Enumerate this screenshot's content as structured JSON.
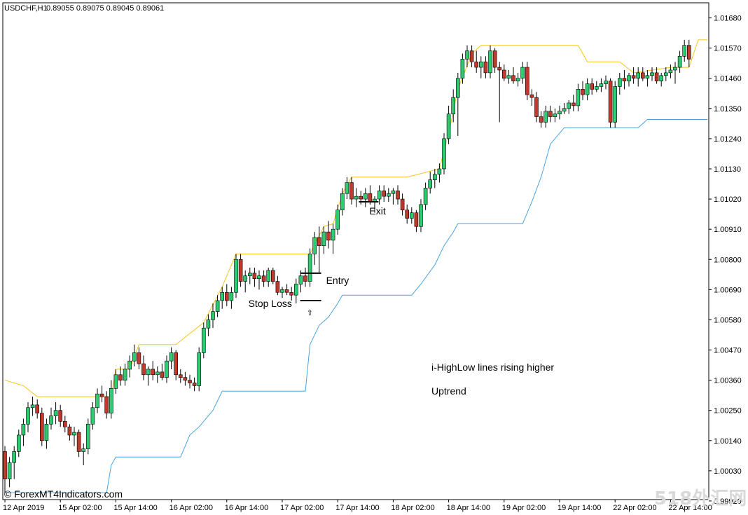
{
  "header": {
    "symbol": "USDCHF,H1",
    "ohlc": "0.89055 0.89075 0.89045 0.89061"
  },
  "copyright": "© ForexMT4Indicators.com",
  "watermark": "518外汇网",
  "colors": {
    "background": "#ffffff",
    "bull": "#2ecc71",
    "bear": "#c0392b",
    "wick": "#000000",
    "high_line": "#f5c518",
    "low_line": "#4aa3df",
    "axis": "#000000"
  },
  "chart_data": {
    "type": "candlestick",
    "ylim": [
      0.99925,
      1.01735
    ],
    "y_ticks": [
      "1.01680",
      "1.01570",
      "1.01460",
      "1.01350",
      "1.01240",
      "1.01130",
      "1.01020",
      "1.00910",
      "1.00800",
      "1.00690",
      "1.00580",
      "1.00470",
      "1.00360",
      "1.00250",
      "1.00140",
      "1.00030",
      "0.99920"
    ],
    "x_ticks": [
      "12 Apr 2019",
      "15 Apr 02:00",
      "15 Apr 14:00",
      "16 Apr 02:00",
      "16 Apr 14:00",
      "17 Apr 02:00",
      "17 Apr 14:00",
      "18 Apr 02:00",
      "18 Apr 14:00",
      "19 Apr 02:00",
      "19 Apr 14:00",
      "22 Apr 02:00",
      "22 Apr 14:00"
    ],
    "x_tick_index": [
      0,
      12,
      24,
      36,
      48,
      60,
      72,
      84,
      96,
      108,
      120,
      132,
      144
    ],
    "candles": [
      [
        1.001,
        1.0012,
        0.9995,
        1.0
      ],
      [
        1.0,
        1.0008,
        0.9997,
        1.0006
      ],
      [
        1.0006,
        1.0012,
        1.0,
        1.001
      ],
      [
        1.001,
        1.0018,
        1.0008,
        1.0016
      ],
      [
        1.0016,
        1.0022,
        1.0012,
        1.002
      ],
      [
        1.002,
        1.0028,
        1.0017,
        1.0026
      ],
      [
        1.0026,
        1.003,
        1.0023,
        1.0027
      ],
      [
        1.0027,
        1.0029,
        1.0022,
        1.0024
      ],
      [
        1.0024,
        1.0026,
        1.0012,
        1.0014
      ],
      [
        1.0014,
        1.0022,
        1.0011,
        1.002
      ],
      [
        1.002,
        1.0026,
        1.0018,
        1.0023
      ],
      [
        1.0023,
        1.0028,
        1.002,
        1.0025
      ],
      [
        1.0025,
        1.0027,
        1.0019,
        1.0021
      ],
      [
        1.0021,
        1.0023,
        1.0017,
        1.0019
      ],
      [
        1.0019,
        1.002,
        1.0014,
        1.0016
      ],
      [
        1.0016,
        1.0019,
        1.0012,
        1.0017
      ],
      [
        1.0017,
        1.0018,
        1.0008,
        1.001
      ],
      [
        1.001,
        1.0013,
        1.0005,
        1.0011
      ],
      [
        1.0011,
        1.0022,
        1.0009,
        1.002
      ],
      [
        1.002,
        1.0028,
        1.0018,
        1.0026
      ],
      [
        1.0026,
        1.0033,
        1.0024,
        1.0031
      ],
      [
        1.0031,
        1.0034,
        1.0028,
        1.003
      ],
      [
        1.003,
        1.0032,
        1.0022,
        1.0024
      ],
      [
        1.0024,
        1.0036,
        1.0022,
        1.0033
      ],
      [
        1.0033,
        1.004,
        1.0031,
        1.0038
      ],
      [
        1.0038,
        1.0041,
        1.0034,
        1.0036
      ],
      [
        1.0036,
        1.0042,
        1.0034,
        1.004
      ],
      [
        1.004,
        1.0045,
        1.0037,
        1.0043
      ],
      [
        1.0043,
        1.0049,
        1.0041,
        1.0046
      ],
      [
        1.0046,
        1.0048,
        1.004,
        1.0042
      ],
      [
        1.0042,
        1.0045,
        1.0036,
        1.0038
      ],
      [
        1.0038,
        1.0041,
        1.0034,
        1.004
      ],
      [
        1.004,
        1.0043,
        1.0036,
        1.0038
      ],
      [
        1.0038,
        1.0041,
        1.0035,
        1.0039
      ],
      [
        1.0039,
        1.0042,
        1.0036,
        1.0037
      ],
      [
        1.0037,
        1.0045,
        1.0035,
        1.0043
      ],
      [
        1.0043,
        1.0048,
        1.004,
        1.0046
      ],
      [
        1.0046,
        1.0047,
        1.0036,
        1.0038
      ],
      [
        1.0038,
        1.004,
        1.0035,
        1.0037
      ],
      [
        1.0037,
        1.0039,
        1.0034,
        1.0036
      ],
      [
        1.0036,
        1.0038,
        1.0033,
        1.0035
      ],
      [
        1.0035,
        1.0037,
        1.0032,
        1.0034
      ],
      [
        1.0034,
        1.0048,
        1.0032,
        1.0046
      ],
      [
        1.0046,
        1.0057,
        1.0044,
        1.0055
      ],
      [
        1.0055,
        1.006,
        1.0052,
        1.0058
      ],
      [
        1.0058,
        1.0064,
        1.0055,
        1.0061
      ],
      [
        1.0061,
        1.0067,
        1.0059,
        1.0065
      ],
      [
        1.0065,
        1.007,
        1.0062,
        1.0068
      ],
      [
        1.0068,
        1.0071,
        1.0063,
        1.0065
      ],
      [
        1.0065,
        1.007,
        1.0062,
        1.0068
      ],
      [
        1.0068,
        1.0082,
        1.0066,
        1.008
      ],
      [
        1.008,
        1.0082,
        1.007,
        1.0072
      ],
      [
        1.0072,
        1.0076,
        1.0068,
        1.0074
      ],
      [
        1.0074,
        1.0077,
        1.0071,
        1.0075
      ],
      [
        1.0075,
        1.0077,
        1.007,
        1.0073
      ],
      [
        1.0073,
        1.0076,
        1.0069,
        1.0074
      ],
      [
        1.0074,
        1.0076,
        1.007,
        1.0072
      ],
      [
        1.0072,
        1.0077,
        1.007,
        1.0076
      ],
      [
        1.0076,
        1.0077,
        1.0071,
        1.0072
      ],
      [
        1.0072,
        1.0074,
        1.0067,
        1.0068
      ],
      [
        1.0068,
        1.007,
        1.0066,
        1.0069
      ],
      [
        1.0069,
        1.0071,
        1.0067,
        1.0068
      ],
      [
        1.0068,
        1.007,
        1.0065,
        1.0067
      ],
      [
        1.0067,
        1.0073,
        1.0064,
        1.0071
      ],
      [
        1.0071,
        1.0076,
        1.0068,
        1.0074
      ],
      [
        1.0074,
        1.0077,
        1.007,
        1.0072
      ],
      [
        1.0072,
        1.0084,
        1.007,
        1.0082
      ],
      [
        1.0082,
        1.009,
        1.0078,
        1.0088
      ],
      [
        1.0088,
        1.0092,
        1.0075,
        1.0085
      ],
      [
        1.0085,
        1.0092,
        1.0082,
        1.009
      ],
      [
        1.009,
        1.0094,
        1.0084,
        1.0087
      ],
      [
        1.0087,
        1.0093,
        1.0082,
        1.0091
      ],
      [
        1.0091,
        1.01,
        1.0089,
        1.0098
      ],
      [
        1.0098,
        1.0106,
        1.0096,
        1.0104
      ],
      [
        1.0104,
        1.011,
        1.0102,
        1.0108
      ],
      [
        1.0108,
        1.011,
        1.01,
        1.0102
      ],
      [
        1.0102,
        1.0106,
        1.0099,
        1.0103
      ],
      [
        1.0103,
        1.0105,
        1.01,
        1.0102
      ],
      [
        1.0102,
        1.0106,
        1.0099,
        1.0104
      ],
      [
        1.0104,
        1.0107,
        1.01,
        1.0101
      ],
      [
        1.0101,
        1.0103,
        1.0097,
        1.0102
      ],
      [
        1.0102,
        1.0107,
        1.01,
        1.0105
      ],
      [
        1.0105,
        1.0107,
        1.0101,
        1.0103
      ],
      [
        1.0103,
        1.0106,
        1.0101,
        1.0104
      ],
      [
        1.0104,
        1.0106,
        1.01,
        1.0105
      ],
      [
        1.0105,
        1.0107,
        1.01,
        1.0102
      ],
      [
        1.0102,
        1.0104,
        1.0096,
        1.0098
      ],
      [
        1.0098,
        1.01,
        1.0093,
        1.0095
      ],
      [
        1.0095,
        1.0099,
        1.0093,
        1.0097
      ],
      [
        1.0097,
        1.0098,
        1.009,
        1.0092
      ],
      [
        1.0092,
        1.0102,
        1.009,
        1.01
      ],
      [
        1.01,
        1.0108,
        1.0098,
        1.0106
      ],
      [
        1.0106,
        1.0112,
        1.0104,
        1.0109
      ],
      [
        1.0109,
        1.0113,
        1.0106,
        1.0111
      ],
      [
        1.0111,
        1.0115,
        1.0108,
        1.0113
      ],
      [
        1.0113,
        1.0126,
        1.0111,
        1.0124
      ],
      [
        1.0124,
        1.0136,
        1.0122,
        1.0133
      ],
      [
        1.0133,
        1.0142,
        1.013,
        1.0139
      ],
      [
        1.0139,
        1.0148,
        1.0125,
        1.0146
      ],
      [
        1.0146,
        1.0155,
        1.0144,
        1.0153
      ],
      [
        1.0153,
        1.0158,
        1.015,
        1.0156
      ],
      [
        1.0156,
        1.0158,
        1.015,
        1.0152
      ],
      [
        1.0152,
        1.0156,
        1.0148,
        1.015
      ],
      [
        1.015,
        1.0154,
        1.0146,
        1.0152
      ],
      [
        1.0152,
        1.0154,
        1.0146,
        1.0148
      ],
      [
        1.0148,
        1.0158,
        1.0146,
        1.0156
      ],
      [
        1.0156,
        1.0157,
        1.0148,
        1.015
      ],
      [
        1.015,
        1.0152,
        1.013,
        1.0149
      ],
      [
        1.0149,
        1.0151,
        1.0145,
        1.0146
      ],
      [
        1.0146,
        1.0149,
        1.0144,
        1.0147
      ],
      [
        1.0147,
        1.015,
        1.0144,
        1.0145
      ],
      [
        1.0145,
        1.0148,
        1.0143,
        1.0146
      ],
      [
        1.0146,
        1.0152,
        1.0144,
        1.015
      ],
      [
        1.015,
        1.0152,
        1.0138,
        1.014
      ],
      [
        1.014,
        1.0142,
        1.0136,
        1.0139
      ],
      [
        1.0139,
        1.0141,
        1.013,
        1.0132
      ],
      [
        1.0132,
        1.0134,
        1.0128,
        1.013
      ],
      [
        1.013,
        1.0136,
        1.0128,
        1.0134
      ],
      [
        1.0134,
        1.0136,
        1.013,
        1.0132
      ],
      [
        1.0132,
        1.0135,
        1.013,
        1.0133
      ],
      [
        1.0133,
        1.0136,
        1.0131,
        1.0134
      ],
      [
        1.0134,
        1.0137,
        1.0133,
        1.0135
      ],
      [
        1.0135,
        1.0138,
        1.0133,
        1.0137
      ],
      [
        1.0137,
        1.014,
        1.0134,
        1.0136
      ],
      [
        1.0136,
        1.0144,
        1.0134,
        1.0142
      ],
      [
        1.0142,
        1.0145,
        1.0138,
        1.014
      ],
      [
        1.014,
        1.0146,
        1.0138,
        1.0144
      ],
      [
        1.0144,
        1.0146,
        1.014,
        1.0142
      ],
      [
        1.0142,
        1.0145,
        1.0141,
        1.0143
      ],
      [
        1.0143,
        1.0146,
        1.0141,
        1.0144
      ],
      [
        1.0144,
        1.0147,
        1.0142,
        1.0145
      ],
      [
        1.0145,
        1.0146,
        1.0128,
        1.013
      ],
      [
        1.013,
        1.0145,
        1.0128,
        1.0143
      ],
      [
        1.0143,
        1.0148,
        1.014,
        1.0146
      ],
      [
        1.0146,
        1.0149,
        1.0142,
        1.0145
      ],
      [
        1.0145,
        1.0148,
        1.0143,
        1.0147
      ],
      [
        1.0147,
        1.015,
        1.0144,
        1.0146
      ],
      [
        1.0146,
        1.015,
        1.0143,
        1.0148
      ],
      [
        1.0148,
        1.015,
        1.0145,
        1.0146
      ],
      [
        1.0146,
        1.0149,
        1.0143,
        1.0147
      ],
      [
        1.0147,
        1.015,
        1.0145,
        1.0148
      ],
      [
        1.0148,
        1.015,
        1.0144,
        1.0145
      ],
      [
        1.0145,
        1.0148,
        1.0143,
        1.0147
      ],
      [
        1.0147,
        1.015,
        1.0145,
        1.0148
      ],
      [
        1.0148,
        1.0151,
        1.0146,
        1.0149
      ],
      [
        1.0149,
        1.0152,
        1.0144,
        1.015
      ],
      [
        1.015,
        1.0156,
        1.0148,
        1.0154
      ],
      [
        1.0154,
        1.016,
        1.0152,
        1.0158
      ],
      [
        1.0158,
        1.016,
        1.015,
        1.0153
      ]
    ],
    "high_line": [
      [
        0,
        1.0036
      ],
      [
        4,
        1.0034
      ],
      [
        7,
        1.003
      ],
      [
        12,
        1.003
      ],
      [
        23,
        1.003
      ],
      [
        24,
        1.004
      ],
      [
        27,
        1.004
      ],
      [
        29,
        1.0049
      ],
      [
        37,
        1.0049
      ],
      [
        43,
        1.0057
      ],
      [
        47,
        1.007
      ],
      [
        50,
        1.0082
      ],
      [
        66,
        1.0082
      ],
      [
        69,
        1.0092
      ],
      [
        71,
        1.0093
      ],
      [
        73,
        1.0104
      ],
      [
        75,
        1.011
      ],
      [
        87,
        1.011
      ],
      [
        94,
        1.0113
      ],
      [
        96,
        1.0126
      ],
      [
        98,
        1.0142
      ],
      [
        101,
        1.0155
      ],
      [
        103,
        1.0158
      ],
      [
        124,
        1.0158
      ],
      [
        126,
        1.0152
      ],
      [
        133,
        1.0152
      ],
      [
        136,
        1.0148
      ],
      [
        144,
        1.015
      ],
      [
        148,
        1.015
      ],
      [
        150,
        1.016
      ],
      [
        152,
        1.016
      ]
    ],
    "low_line": [
      [
        0,
        0.9995
      ],
      [
        22,
        0.9995
      ],
      [
        23,
        1.0005
      ],
      [
        24,
        1.0008
      ],
      [
        38,
        1.0008
      ],
      [
        40,
        1.0016
      ],
      [
        42,
        1.0019
      ],
      [
        45,
        1.0025
      ],
      [
        47,
        1.0032
      ],
      [
        65,
        1.0032
      ],
      [
        66,
        1.0049
      ],
      [
        68,
        1.0056
      ],
      [
        70,
        1.0059
      ],
      [
        72,
        1.0064
      ],
      [
        73,
        1.0067
      ],
      [
        88,
        1.0067
      ],
      [
        90,
        1.0071
      ],
      [
        93,
        1.0078
      ],
      [
        95,
        1.0085
      ],
      [
        97,
        1.009
      ],
      [
        98,
        1.0093
      ],
      [
        112,
        1.0093
      ],
      [
        114,
        1.0101
      ],
      [
        116,
        1.011
      ],
      [
        118,
        1.0122
      ],
      [
        121,
        1.0128
      ],
      [
        137,
        1.0128
      ],
      [
        139,
        1.0131
      ],
      [
        152,
        1.0131
      ]
    ],
    "annotations": {
      "entry": {
        "text": "Entry",
        "index": 66,
        "price": 1.0075
      },
      "stop_loss": {
        "text": "Stop Loss",
        "index": 66,
        "price": 1.0065
      },
      "exit": {
        "text": "Exit",
        "index": 79,
        "price": 1.0101
      },
      "note_line1": "i-HighLow lines rising higher",
      "note_line2": "Uptrend",
      "arrow": "⇧"
    }
  }
}
